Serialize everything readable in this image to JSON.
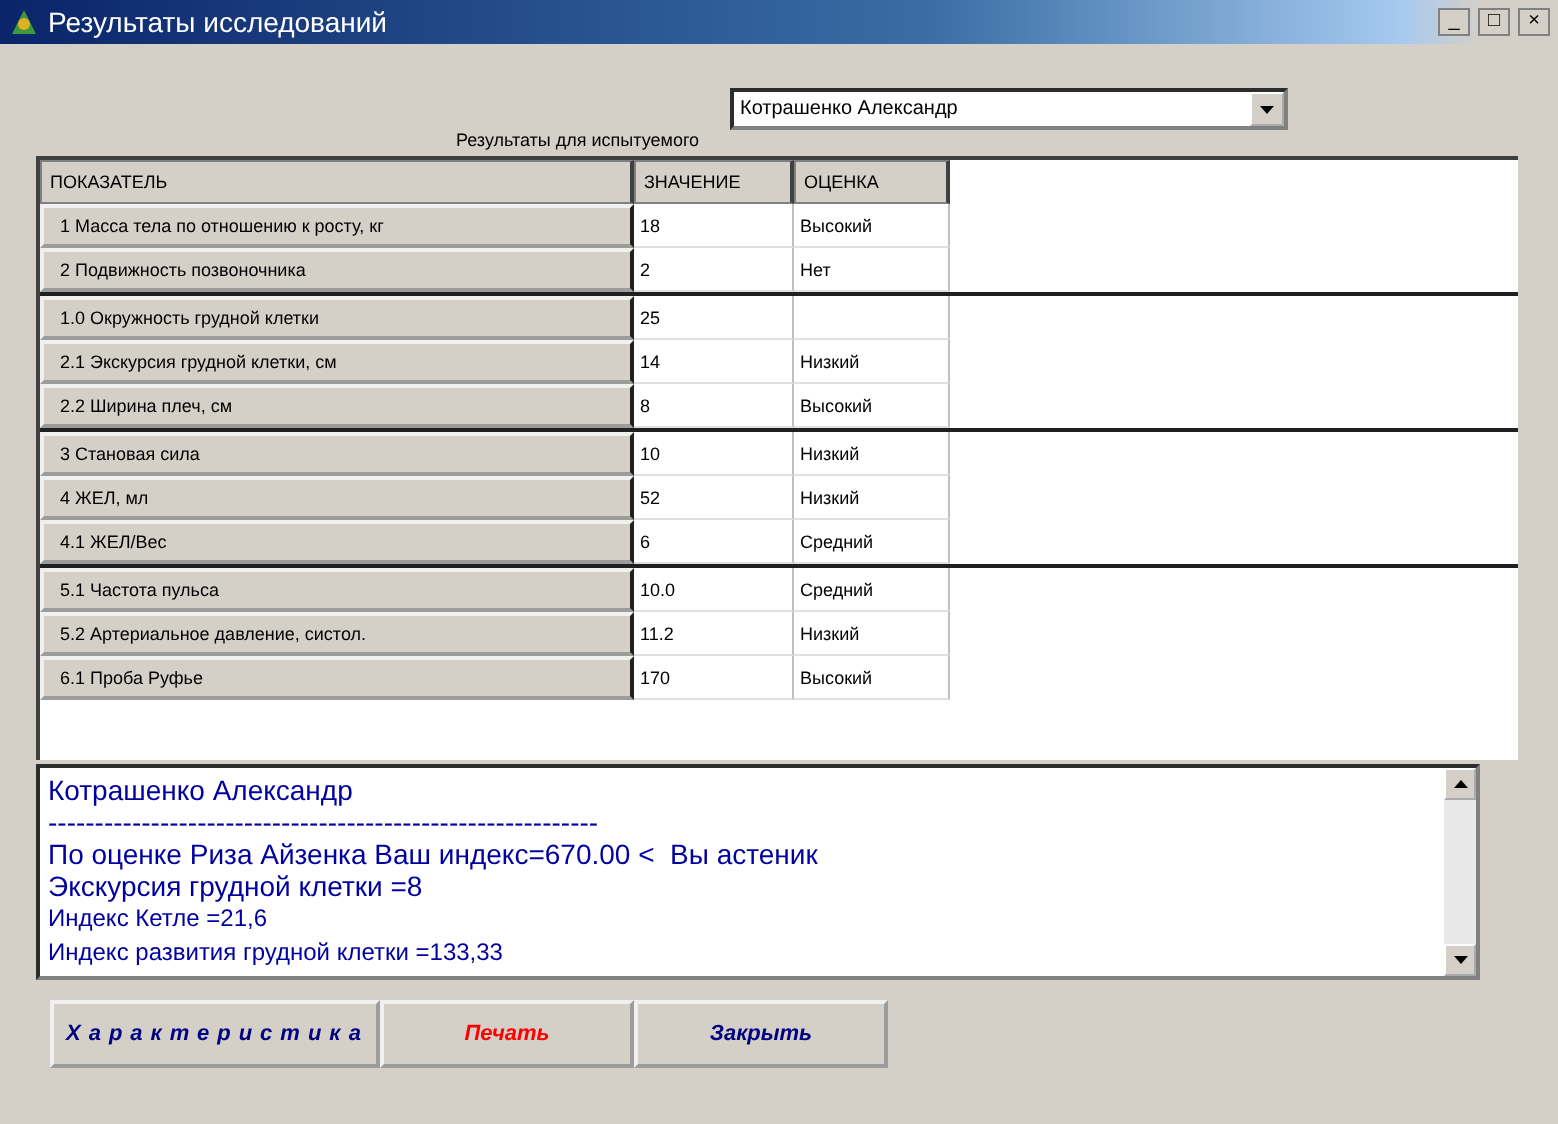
{
  "window": {
    "title": "Результаты исследований",
    "controls": [
      "_",
      "□",
      "×"
    ]
  },
  "subject_select": {
    "value": "Котрашенко Александр",
    "label": "Результаты для испытуемого"
  },
  "table": {
    "columns": [
      "ПОКАЗАТЕЛЬ",
      "ЗНАЧЕНИЕ",
      "ОЦЕНКА"
    ],
    "groups": [
      {
        "rows": [
          [
            "1 Масса тела по отношению к росту, кг",
            "18",
            "Высокий"
          ],
          [
            "2 Подвижность позвоночника",
            "2",
            "Нет"
          ]
        ]
      },
      {
        "rows": [
          [
            "1.0 Окружность грудной клетки",
            "25",
            ""
          ],
          [
            "2.1 Экскурсия грудной клетки, см",
            "14",
            "Низкий"
          ],
          [
            "2.2 Ширина плеч, см",
            "8",
            "Высокий"
          ]
        ]
      },
      {
        "rows": [
          [
            "3 Становая сила",
            "10",
            "Низкий"
          ],
          [
            "4 ЖЕЛ, мл",
            "52",
            "Низкий"
          ],
          [
            "4.1 ЖЕЛ/Вес",
            "6",
            "Средний"
          ]
        ]
      },
      {
        "rows": [
          [
            "5.1 Частота пульса",
            "10.0",
            "Средний"
          ],
          [
            "5.2 Артериальное давление, систол.",
            "11.2",
            "Низкий"
          ],
          [
            "6.1 Проба Руфье",
            "170",
            "Высокий"
          ]
        ]
      }
    ]
  },
  "report": {
    "lines": [
      {
        "kind": "big",
        "text": "Котрашенко Александр"
      },
      {
        "kind": "big",
        "text": "-----------------------------------------------------------"
      },
      {
        "kind": "big",
        "text": "По оценке Риза Айзенка Ваш индекс=670.00 <  Вы астеник"
      },
      {
        "kind": "big",
        "text": "Экскурсия грудной клетки =8"
      },
      {
        "kind": "small",
        "text": "Индекс Кетле =21,6"
      },
      {
        "kind": "small",
        "text": "Индекс развития грудной клетки =133,33"
      }
    ]
  },
  "buttons": [
    {
      "label": "Характеристика",
      "color": "#000080"
    },
    {
      "label": "Печать",
      "color": "#ff0000"
    },
    {
      "label": "Закрыть",
      "color": "#000080"
    }
  ]
}
